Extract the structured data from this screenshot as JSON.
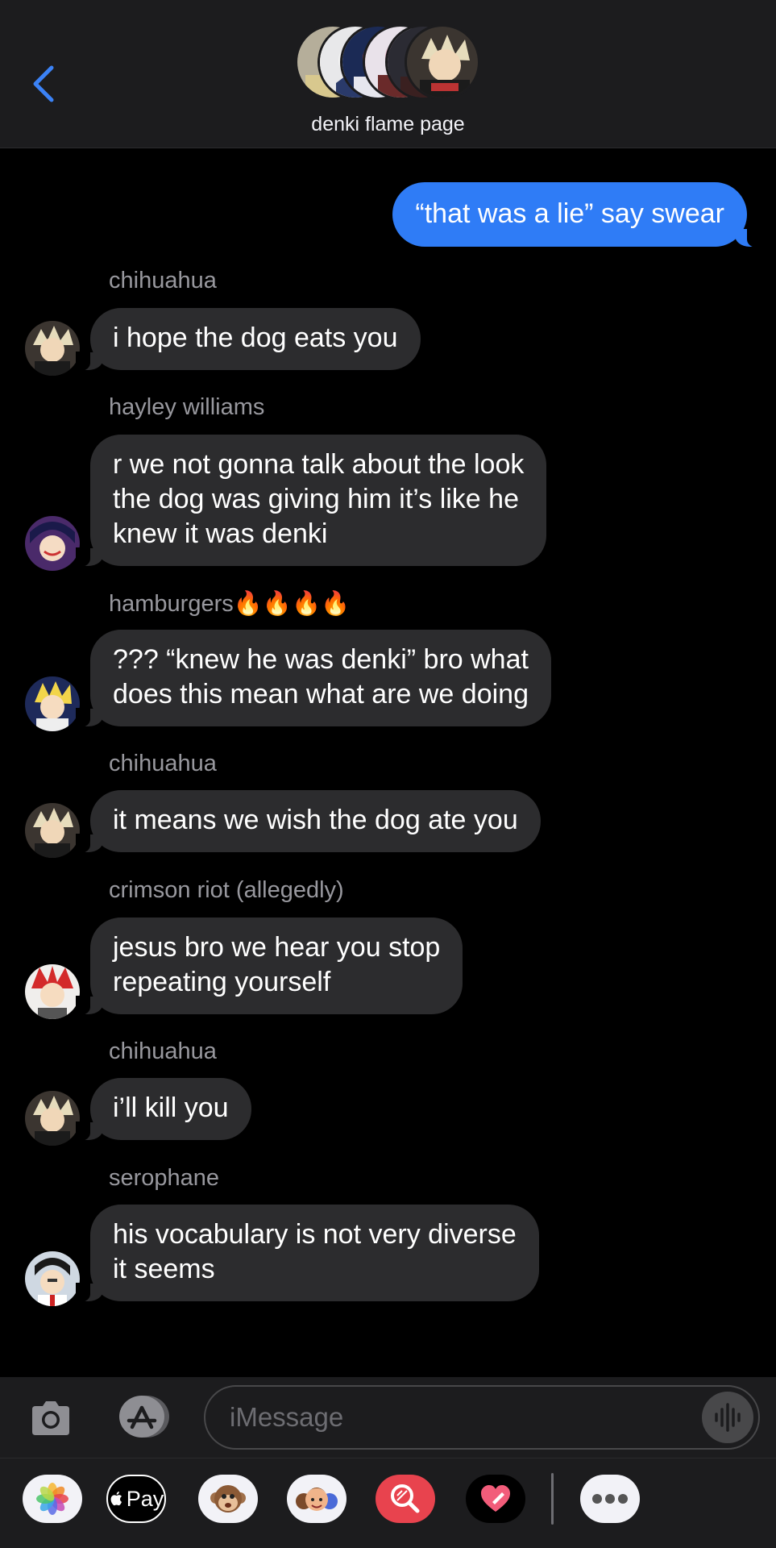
{
  "header": {
    "title": "denki flame page",
    "back_label": "Back"
  },
  "colors": {
    "sent_bubble": "#2f7cf6",
    "received_bubble": "#2c2c2e",
    "back_chevron": "#3b82f6",
    "sender_name": "#98989e"
  },
  "messages": {
    "sent_1": "“that was a lie” say swear",
    "m1": {
      "sender": "chihuahua",
      "text": "i hope the dog eats you"
    },
    "m2": {
      "sender": "hayley williams",
      "lines": [
        "r we not gonna talk about the look",
        "the dog was giving him it’s like he",
        "knew it was denki"
      ]
    },
    "m3": {
      "sender": "hamburgers🔥🔥🔥🔥",
      "lines": [
        "??? “knew he was denki” bro what",
        "does this mean what are we doing"
      ]
    },
    "m4": {
      "sender": "chihuahua",
      "text": "it means we wish the dog ate you"
    },
    "m5": {
      "sender": "crimson riot (allegedly)",
      "lines": [
        "jesus bro we hear you stop",
        "repeating yourself"
      ]
    },
    "m6": {
      "sender": "chihuahua",
      "text": "i’ll kill you"
    },
    "m7": {
      "sender": "serophane",
      "lines": [
        "his vocabulary is not very diverse",
        "it seems"
      ]
    }
  },
  "input": {
    "placeholder": "iMessage"
  },
  "apps": {
    "applepay_label": "Pay",
    "icons": [
      "photos-icon",
      "apple-pay-icon",
      "animoji-icon",
      "memoji-icon",
      "image-search-icon",
      "digital-touch-icon",
      "more-apps-icon"
    ]
  }
}
